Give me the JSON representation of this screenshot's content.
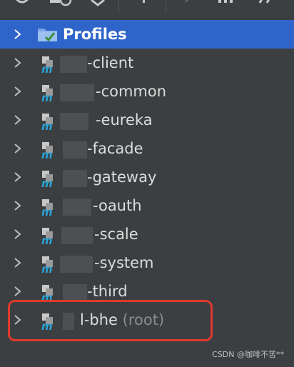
{
  "tree": {
    "root": {
      "label": "Profiles",
      "icon": "profiles-icon"
    },
    "modules": [
      {
        "suffix": "-client"
      },
      {
        "suffix": "-common"
      },
      {
        "suffix": "-eureka"
      },
      {
        "suffix": "-facade"
      },
      {
        "suffix": "-gateway"
      },
      {
        "suffix": "-oauth"
      },
      {
        "suffix": "-scale"
      },
      {
        "suffix": "-system"
      },
      {
        "suffix": "-third"
      },
      {
        "suffix": "l-bhe",
        "tag": "(root)"
      }
    ],
    "module_icon": "maven-module-icon"
  },
  "watermark": "CSDN @咖啡不苦**",
  "colors": {
    "background": "#3c3f41",
    "selection": "#2f65ca",
    "highlight": "#e0392b",
    "maven_m": "#2aa5d8"
  }
}
